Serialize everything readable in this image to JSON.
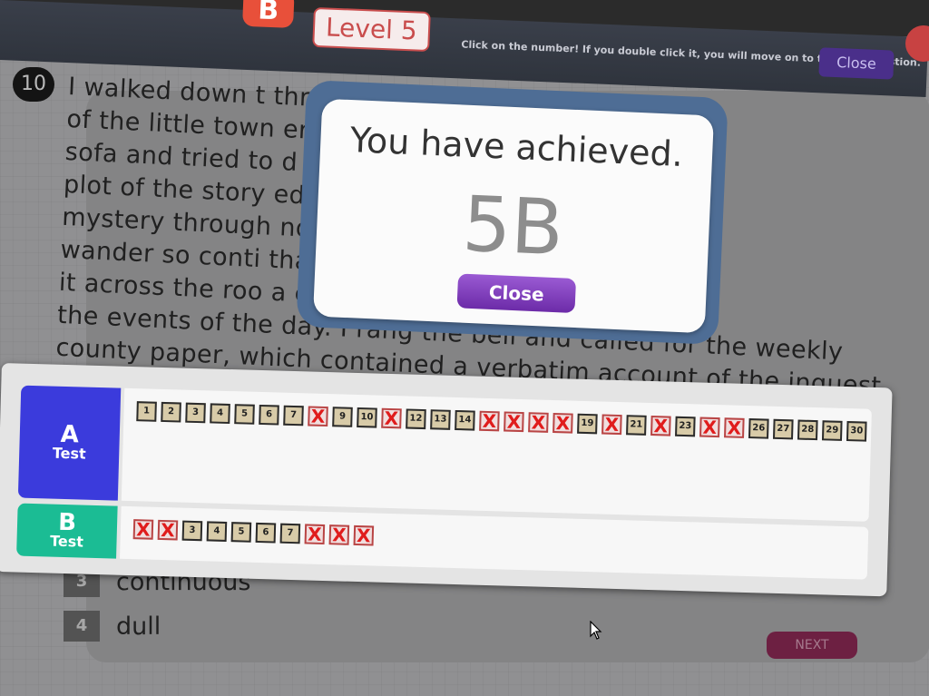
{
  "header": {
    "logo_letter": "B",
    "level_label": "Level 5",
    "instruction": "Click on the number! If you double click it, you will move on to the next question.",
    "close_label": "Close"
  },
  "question": {
    "number": "10",
    "passage_lines": [
      "I walked down t                                          through the streets",
      "of the little town                                          ere I lay upon the",
      "sofa and tried to                                          d novel. The puny",
      "plot of the story                                          ed to the deep",
      "mystery through                                          nd my attention",
      "wander so conti                                          that I at last flung",
      "it across the roo                                          a consideration of",
      "the events of the day. I rang the bell and called for the weekly",
      "county paper, which contained a verbatim account of the inquest"
    ],
    "options": [
      {
        "num": "3",
        "text": "continuous"
      },
      {
        "num": "4",
        "text": "dull"
      }
    ],
    "next_label": "NEXT"
  },
  "popup": {
    "title": "You have achieved.",
    "grade": "5B",
    "close_label": "Close"
  },
  "results": {
    "a_letter": "A",
    "a_label": "Test",
    "b_letter": "B",
    "b_label": "Test",
    "a_items": [
      {
        "n": "1",
        "wrong": false
      },
      {
        "n": "2",
        "wrong": false
      },
      {
        "n": "3",
        "wrong": false
      },
      {
        "n": "4",
        "wrong": false
      },
      {
        "n": "5",
        "wrong": false
      },
      {
        "n": "6",
        "wrong": false
      },
      {
        "n": "7",
        "wrong": false
      },
      {
        "n": "8",
        "wrong": true
      },
      {
        "n": "9",
        "wrong": false
      },
      {
        "n": "10",
        "wrong": false
      },
      {
        "n": "11",
        "wrong": true
      },
      {
        "n": "12",
        "wrong": false
      },
      {
        "n": "13",
        "wrong": false
      },
      {
        "n": "14",
        "wrong": false
      },
      {
        "n": "15",
        "wrong": true
      },
      {
        "n": "16",
        "wrong": true
      },
      {
        "n": "17",
        "wrong": true
      },
      {
        "n": "18",
        "wrong": true
      },
      {
        "n": "19",
        "wrong": false
      },
      {
        "n": "20",
        "wrong": true
      },
      {
        "n": "21",
        "wrong": false
      },
      {
        "n": "22",
        "wrong": true
      },
      {
        "n": "23",
        "wrong": false
      },
      {
        "n": "24",
        "wrong": true
      },
      {
        "n": "25",
        "wrong": true
      },
      {
        "n": "26",
        "wrong": false
      },
      {
        "n": "27",
        "wrong": false
      },
      {
        "n": "28",
        "wrong": false
      },
      {
        "n": "29",
        "wrong": false
      },
      {
        "n": "30",
        "wrong": false
      }
    ],
    "b_items": [
      {
        "n": "1",
        "wrong": true
      },
      {
        "n": "2",
        "wrong": true
      },
      {
        "n": "3",
        "wrong": false
      },
      {
        "n": "4",
        "wrong": false
      },
      {
        "n": "5",
        "wrong": false
      },
      {
        "n": "6",
        "wrong": false
      },
      {
        "n": "7",
        "wrong": false
      },
      {
        "n": "8",
        "wrong": true
      },
      {
        "n": "9",
        "wrong": true
      },
      {
        "n": "10",
        "wrong": true
      }
    ],
    "wrong_mark": "X"
  },
  "colors": {
    "test_a_tab": "#3b3bdc",
    "test_b_tab": "#1bbc94",
    "popup_close": "#7b3cc0",
    "wrong_mark": "#e01c1c",
    "level_badge": "#c94d4d"
  },
  "icons": {
    "cursor": "mouse-pointer-icon",
    "wrong": "x-mark-icon"
  }
}
